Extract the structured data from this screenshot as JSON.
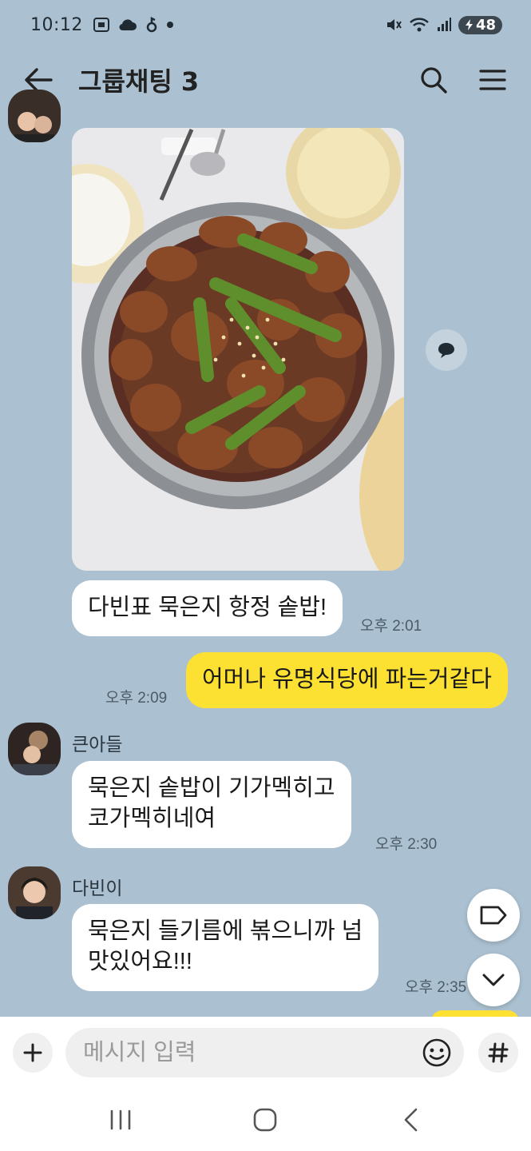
{
  "status_bar": {
    "time": "10:12",
    "battery": "48"
  },
  "header": {
    "title": "그룹채팅 3"
  },
  "messages": {
    "m1_text": "다빈표 묵은지 항정 솥밥!",
    "m1_time": "오후 2:01",
    "m2_text": "어머나 유명식당에 파는거같다",
    "m2_time": "오후 2:09",
    "m3_sender": "큰아들",
    "m3_line1": "묵은지 솥밥이 기가멕히고",
    "m3_line2": "코가멕히네여",
    "m3_time": "오후 2:30",
    "m4_sender": "다빈이",
    "m4_line1": "묵은지 들기름에 볶으니까 넘",
    "m4_line2": "맛있어요!!!",
    "m4_time": "오후 2:35"
  },
  "input": {
    "placeholder": "메시지 입력"
  },
  "icons": {
    "back": "arrow-left-icon",
    "search": "search-icon",
    "menu": "hamburger-menu-icon",
    "share": "speech-bubble-icon",
    "tag": "tag-icon",
    "scroll_down": "chevron-down-icon",
    "plus": "plus-icon",
    "emoji": "smiley-icon",
    "hash": "hash-icon"
  },
  "colors": {
    "background": "#abc1d1",
    "my_bubble": "#fde132",
    "other_bubble": "#ffffff"
  }
}
